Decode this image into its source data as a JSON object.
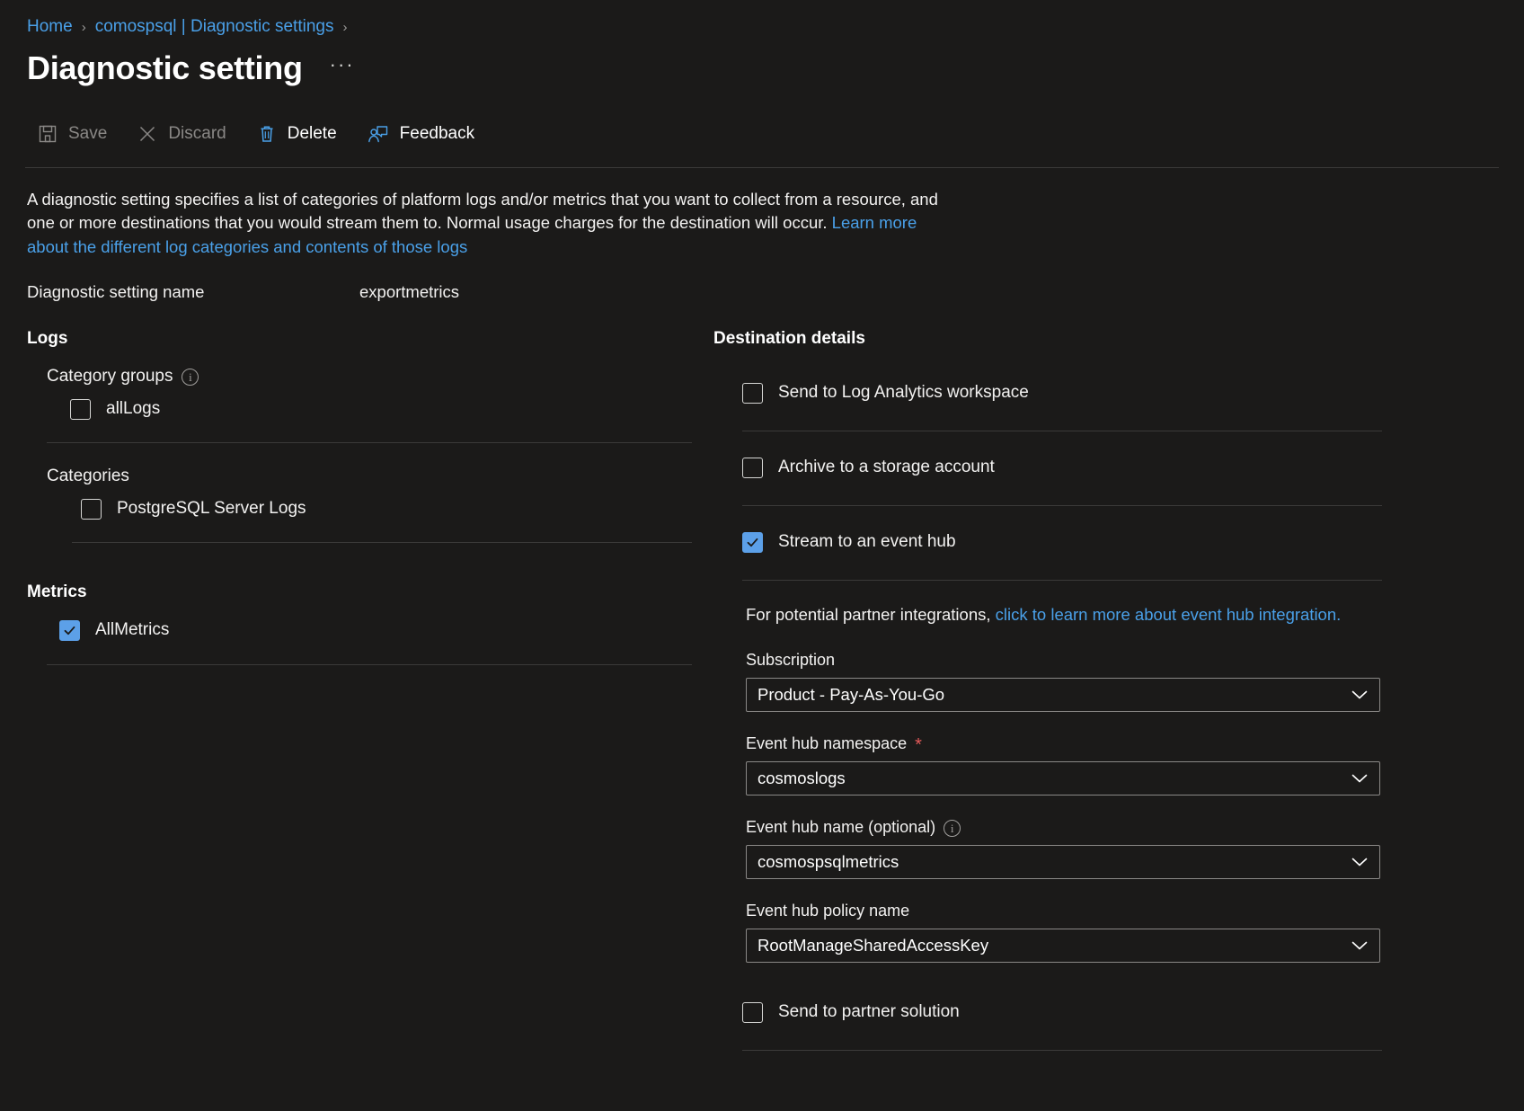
{
  "breadcrumb": {
    "items": [
      {
        "label": "Home"
      },
      {
        "label": "comospsql | Diagnostic settings"
      }
    ],
    "separator": "›"
  },
  "header": {
    "title": "Diagnostic setting",
    "more_label": "···"
  },
  "toolbar": {
    "save_label": "Save",
    "discard_label": "Discard",
    "delete_label": "Delete",
    "feedback_label": "Feedback"
  },
  "description": {
    "text_before_link": "A diagnostic setting specifies a list of categories of platform logs and/or metrics that you want to collect from a resource, and one or more destinations that you would stream them to. Normal usage charges for the destination will occur. ",
    "link_label": "Learn more about the different log categories and contents of those logs"
  },
  "setting_name": {
    "label": "Diagnostic setting name",
    "value": "exportmetrics"
  },
  "logs": {
    "section_label": "Logs",
    "category_groups_label": "Category groups",
    "category_groups_info": "info-icon",
    "category_groups": [
      {
        "label": "allLogs",
        "checked": false
      }
    ],
    "categories_label": "Categories",
    "categories": [
      {
        "label": "PostgreSQL Server Logs",
        "checked": false
      }
    ]
  },
  "metrics": {
    "section_label": "Metrics",
    "items": [
      {
        "label": "AllMetrics",
        "checked": true
      }
    ]
  },
  "destination": {
    "section_label": "Destination details",
    "log_analytics_label": "Send to Log Analytics workspace",
    "log_analytics_checked": false,
    "storage_label": "Archive to a storage account",
    "storage_checked": false,
    "event_hub_label": "Stream to an event hub",
    "event_hub_checked": true,
    "partner_note_prefix": "For potential partner integrations, ",
    "partner_note_link": "click to learn more about event hub integration.",
    "partner_solution_label": "Send to partner solution",
    "partner_solution_checked": false,
    "fields": {
      "subscription": {
        "label": "Subscription",
        "value": "Product - Pay-As-You-Go"
      },
      "namespace": {
        "label": "Event hub namespace",
        "required_marker": "*",
        "value": "cosmoslogs"
      },
      "hub_name": {
        "label": "Event hub name (optional)",
        "info": "info-icon",
        "value": "cosmospsqlmetrics"
      },
      "policy_name": {
        "label": "Event hub policy name",
        "value": "RootManageSharedAccessKey"
      }
    }
  },
  "colors": {
    "background": "#1b1a19",
    "accent_blue": "#4aa0e8",
    "checkbox_blue": "#5ca0e8",
    "required_red": "#e55a5a",
    "divider": "#3b3a39"
  }
}
